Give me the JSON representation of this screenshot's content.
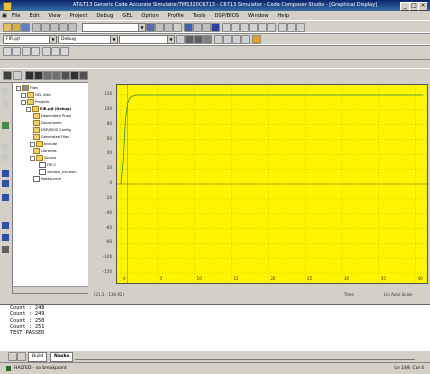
{
  "window": {
    "title": "AT&T13 Generic Code Accurate Simulator/TMS320C6713 - C6713 Simulator - Code Composer Studio - [Graphical Display]"
  },
  "menu": [
    "File",
    "Edit",
    "View",
    "Project",
    "Debug",
    "GEL",
    "Option",
    "Profile",
    "Tools",
    "DSP/BIOS",
    "Window",
    "Help"
  ],
  "toolbar2": {
    "project_combo": "FIR.pjt",
    "config_combo": "Debug"
  },
  "tree": {
    "root": "Files",
    "items": [
      "GEL files",
      "Projects",
      "FIR.pjt (Debug)",
      "Dependent Proje",
      "Documents",
      "DSP/BIOS Config",
      "Generated Files",
      "Include",
      "Libraries",
      "Source",
      "FIR.C",
      "vectors_intr.asm",
      "Nasko.cmd"
    ]
  },
  "graph": {
    "yticks": [
      "150",
      "100",
      "80",
      "60",
      "40",
      "20",
      "0",
      "-20",
      "-40",
      "-60",
      "-80",
      "-100",
      "-150"
    ],
    "xticks": [
      "0",
      "5",
      "10",
      "15",
      "20",
      "25",
      "30",
      "35",
      "40"
    ],
    "status_left": "(21.5, -136.92)",
    "status_time": "Time",
    "status_right": "Lin Auto Scale",
    "trace_color": "#2e8b57"
  },
  "chart_data": {
    "type": "line",
    "title": "",
    "xlabel": "",
    "ylabel": "",
    "x": [
      0,
      0.3,
      0.6,
      0.9,
      1.2,
      1.5,
      2,
      41
    ],
    "y": [
      0,
      40,
      110,
      136,
      145,
      148,
      150,
      150
    ],
    "ylim": [
      -150,
      150
    ],
    "xlim": [
      0,
      41
    ]
  },
  "output": [
    "Count : 248",
    "Count : 249",
    "Count : 250",
    "Count : 251",
    "TEST PASSED"
  ],
  "bottom_tabs": [
    "Build",
    "Nasko"
  ],
  "statusbar": {
    "left": "HALTED - so breakpoint",
    "right": "Ln 149, Col 4"
  }
}
